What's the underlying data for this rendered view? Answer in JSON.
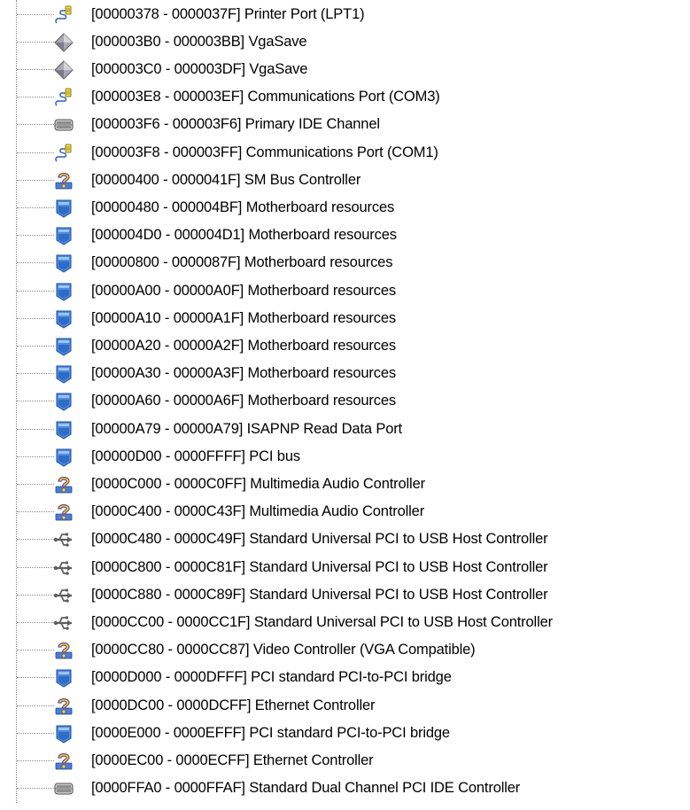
{
  "tree": {
    "items": [
      {
        "icon": "port-icon",
        "range": "[00000378 - 0000037F]",
        "name": "Printer Port (LPT1)"
      },
      {
        "icon": "display-adapter-icon",
        "range": "[000003B0 - 000003BB]",
        "name": "VgaSave"
      },
      {
        "icon": "display-adapter-icon",
        "range": "[000003C0 - 000003DF]",
        "name": "VgaSave"
      },
      {
        "icon": "port-icon",
        "range": "[000003E8 - 000003EF]",
        "name": "Communications Port (COM3)"
      },
      {
        "icon": "ide-controller-icon",
        "range": "[000003F6 - 000003F6]",
        "name": "Primary IDE Channel"
      },
      {
        "icon": "port-icon",
        "range": "[000003F8 - 000003FF]",
        "name": "Communications Port (COM1)"
      },
      {
        "icon": "unknown-device-icon",
        "range": "[00000400 - 0000041F]",
        "name": "SM Bus Controller"
      },
      {
        "icon": "system-device-icon",
        "range": "[00000480 - 000004BF]",
        "name": "Motherboard resources"
      },
      {
        "icon": "system-device-icon",
        "range": "[000004D0 - 000004D1]",
        "name": "Motherboard resources"
      },
      {
        "icon": "system-device-icon",
        "range": "[00000800 - 0000087F]",
        "name": "Motherboard resources"
      },
      {
        "icon": "system-device-icon",
        "range": "[00000A00 - 00000A0F]",
        "name": "Motherboard resources"
      },
      {
        "icon": "system-device-icon",
        "range": "[00000A10 - 00000A1F]",
        "name": "Motherboard resources"
      },
      {
        "icon": "system-device-icon",
        "range": "[00000A20 - 00000A2F]",
        "name": "Motherboard resources"
      },
      {
        "icon": "system-device-icon",
        "range": "[00000A30 - 00000A3F]",
        "name": "Motherboard resources"
      },
      {
        "icon": "system-device-icon",
        "range": "[00000A60 - 00000A6F]",
        "name": "Motherboard resources"
      },
      {
        "icon": "system-device-icon",
        "range": "[00000A79 - 00000A79]",
        "name": "ISAPNP Read Data Port"
      },
      {
        "icon": "system-device-icon",
        "range": "[00000D00 - 0000FFFF]",
        "name": "PCI bus"
      },
      {
        "icon": "unknown-device-icon",
        "range": "[0000C000 - 0000C0FF]",
        "name": "Multimedia Audio Controller"
      },
      {
        "icon": "unknown-device-icon",
        "range": "[0000C400 - 0000C43F]",
        "name": "Multimedia Audio Controller"
      },
      {
        "icon": "usb-icon",
        "range": "[0000C480 - 0000C49F]",
        "name": "Standard Universal PCI to USB Host Controller"
      },
      {
        "icon": "usb-icon",
        "range": "[0000C800 - 0000C81F]",
        "name": "Standard Universal PCI to USB Host Controller"
      },
      {
        "icon": "usb-icon",
        "range": "[0000C880 - 0000C89F]",
        "name": "Standard Universal PCI to USB Host Controller"
      },
      {
        "icon": "usb-icon",
        "range": "[0000CC00 - 0000CC1F]",
        "name": "Standard Universal PCI to USB Host Controller"
      },
      {
        "icon": "unknown-device-icon",
        "range": "[0000CC80 - 0000CC87]",
        "name": "Video Controller (VGA Compatible)"
      },
      {
        "icon": "system-device-icon",
        "range": "[0000D000 - 0000DFFF]",
        "name": "PCI standard PCI-to-PCI bridge"
      },
      {
        "icon": "unknown-device-icon",
        "range": "[0000DC00 - 0000DCFF]",
        "name": "Ethernet Controller"
      },
      {
        "icon": "system-device-icon",
        "range": "[0000E000 - 0000EFFF]",
        "name": "PCI standard PCI-to-PCI bridge"
      },
      {
        "icon": "unknown-device-icon",
        "range": "[0000EC00 - 0000ECFF]",
        "name": "Ethernet Controller"
      },
      {
        "icon": "ide-controller-icon",
        "range": "[0000FFA0 - 0000FFAF]",
        "name": "Standard Dual Channel PCI IDE Controller"
      }
    ]
  },
  "colors": {
    "tree_line": "#8a8a8a",
    "port_yellow": "#e8d84a",
    "unknown_yellow": "#f2d21a",
    "unknown_purple": "#6a4c9c",
    "system_blue": "#3f7fd8",
    "usb_gray": "#6e6e6e"
  }
}
